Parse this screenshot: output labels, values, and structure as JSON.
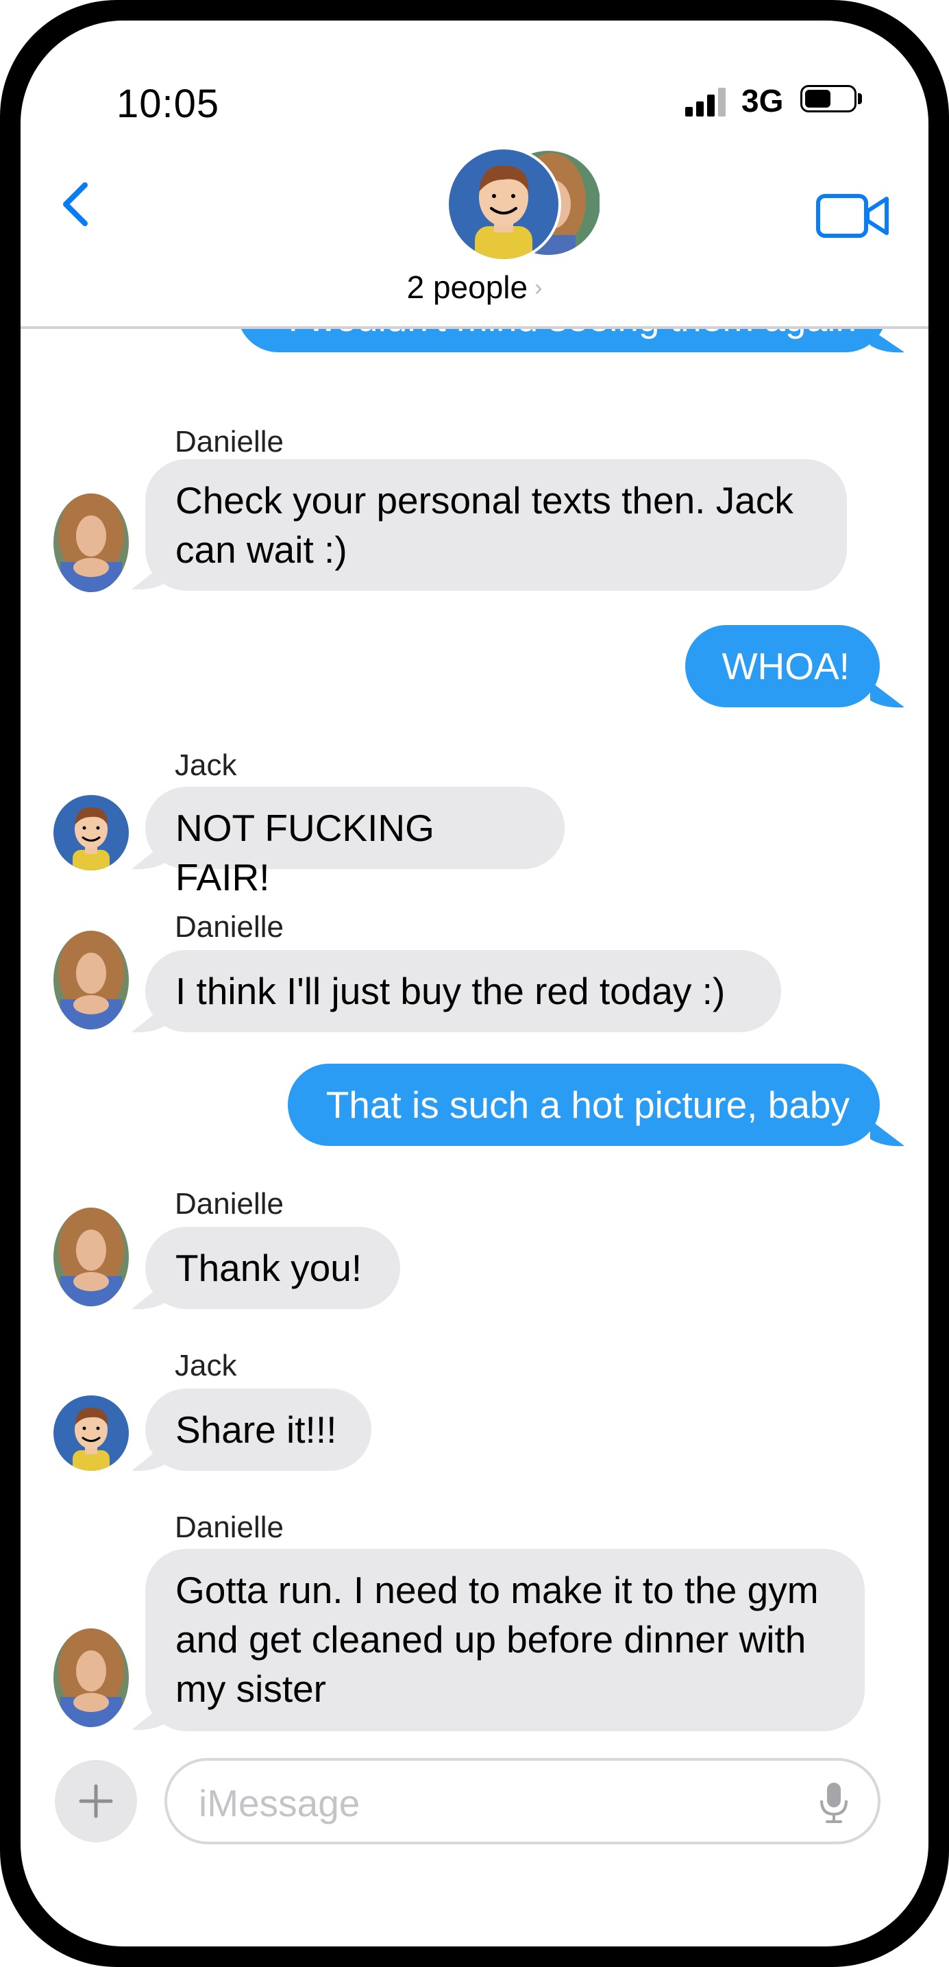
{
  "status_bar": {
    "time": "10:05",
    "network": "3G",
    "battery_level": 0.55
  },
  "header": {
    "subtitle": "2 people",
    "chevron": "›"
  },
  "messages": [
    {
      "direction": "outgoing",
      "text": "I wouldn't mind seeing them again"
    },
    {
      "direction": "incoming",
      "sender": "Danielle",
      "lines": [
        "Check your personal texts then.  Jack",
        "can wait :)"
      ]
    },
    {
      "direction": "outgoing",
      "text": "WHOA!"
    },
    {
      "direction": "incoming",
      "sender": "Jack",
      "text": "NOT FUCKING FAIR!"
    },
    {
      "direction": "incoming",
      "sender": "Danielle",
      "text": "I think I'll just buy the red today :)"
    },
    {
      "direction": "outgoing",
      "text": "That is such a hot picture, baby"
    },
    {
      "direction": "incoming",
      "sender": "Danielle",
      "text": "Thank you!"
    },
    {
      "direction": "incoming",
      "sender": "Jack",
      "text": "Share it!!!"
    },
    {
      "direction": "incoming",
      "sender": "Danielle",
      "lines": [
        "Gotta run.  I need to make it to the gym",
        "and get cleaned up before dinner with",
        "my sister"
      ]
    }
  ],
  "composer": {
    "placeholder": "iMessage"
  },
  "colors": {
    "accent": "#0a7cf4",
    "outgoing_bubble": "#2b9cf3",
    "incoming_bubble": "#e8e8ea"
  }
}
